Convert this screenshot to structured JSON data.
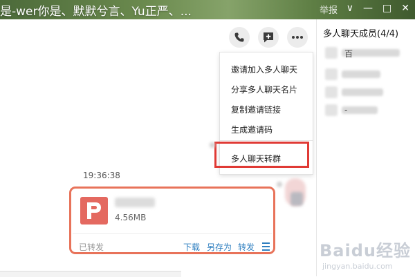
{
  "window": {
    "title": "是-wer你是、默默兮言、Yu正严、...",
    "report": "举报",
    "controls": [
      "∨",
      "—",
      "□",
      "✕"
    ]
  },
  "toolbar": {
    "buttons": [
      {
        "name": "phone-icon"
      },
      {
        "name": "add-chat-icon"
      },
      {
        "name": "more-icon"
      }
    ]
  },
  "dropdown": {
    "items": [
      "邀请加入多人聊天",
      "分享多人聊天名片",
      "复制邀请链接",
      "生成邀请码",
      "多人聊天转群"
    ]
  },
  "message": {
    "timestamp": "19:36:38",
    "file_icon_letter": "P",
    "file_size": "4.56MB",
    "status": "已转发",
    "actions": [
      "下载",
      "另存为",
      "转发"
    ]
  },
  "members": {
    "title": "多人聊天成员(4/4)",
    "visible_chars": [
      "百",
      "",
      "",
      "-"
    ]
  },
  "watermark": {
    "logo": "Baidu经验",
    "url": "jingyan.baidu.com"
  },
  "colors": {
    "accent_blue": "#2f7fc0",
    "highlight_red": "#e03a35",
    "card_border": "#e8735a",
    "file_icon": "#e46960"
  }
}
